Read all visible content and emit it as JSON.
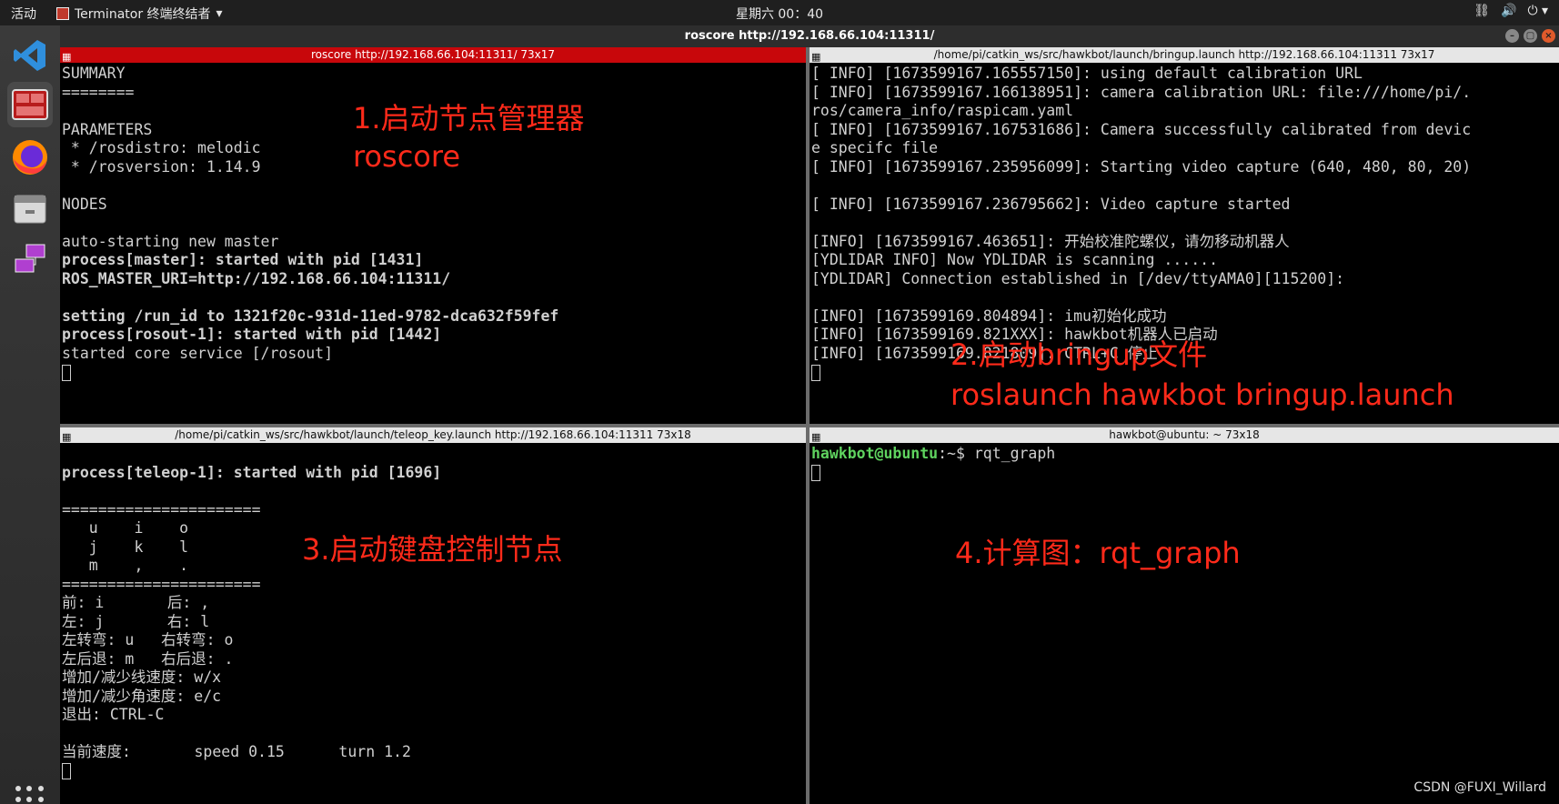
{
  "topbar": {
    "activities": "活动",
    "app_name": "Terminator 终端终结者",
    "clock": "星期六 00：40",
    "tray": [
      "network-icon",
      "volume-icon",
      "power-icon"
    ]
  },
  "window": {
    "title": "roscore http://192.168.66.104:11311/"
  },
  "panes": {
    "top_left": {
      "title": "roscore http://192.168.66.104:11311/ 73x17",
      "lines": [
        "SUMMARY",
        "========",
        "",
        "PARAMETERS",
        " * /rosdistro: melodic",
        " * /rosversion: 1.14.9",
        "",
        "NODES",
        "",
        "auto-starting new master",
        "process[master]: started with pid [1431]",
        "ROS_MASTER_URI=http://192.168.66.104:11311/",
        "",
        "setting /run_id to 1321f20c-931d-11ed-9782-dca632f59fef",
        "process[rosout-1]: started with pid [1442]",
        "started core service [/rosout]"
      ]
    },
    "top_right": {
      "title": "/home/pi/catkin_ws/src/hawkbot/launch/bringup.launch http://192.168.66.104:11311 73x17",
      "lines": [
        "[ INFO] [1673599167.165557150]: using default calibration URL",
        "[ INFO] [1673599167.166138951]: camera calibration URL: file:///home/pi/.",
        "ros/camera_info/raspicam.yaml",
        "[ INFO] [1673599167.167531686]: Camera successfully calibrated from devic",
        "e specifc file",
        "[ INFO] [1673599167.235956099]: Starting video capture (640, 480, 80, 20)",
        "",
        "[ INFO] [1673599167.236795662]: Video capture started",
        "",
        "[INFO] [1673599167.463651]: 开始校准陀螺仪，请勿移动机器人",
        "[YDLIDAR INFO] Now YDLIDAR is scanning ......",
        "[YDLIDAR] Connection established in [/dev/ttyAMA0][115200]:",
        "",
        "[INFO] [1673599169.804894]: imu初始化成功",
        "[INFO] [1673599169.821XXX]: hawkbot机器人已启动",
        "[INFO] [1673599169.821809]: CTRL+C 停止"
      ]
    },
    "bottom_left": {
      "title": "/home/pi/catkin_ws/src/hawkbot/launch/teleop_key.launch http://192.168.66.104:11311 73x18",
      "lines": [
        "",
        "process[teleop-1]: started with pid [1696]",
        "",
        "======================",
        "   u    i    o",
        "   j    k    l",
        "   m    ,    .",
        "======================",
        "前: i       后: ,",
        "左: j       右: l",
        "左转弯: u   右转弯: o",
        "左后退: m   右后退: .",
        "增加/减少线速度: w/x",
        "增加/减少角速度: e/c",
        "退出: CTRL-C",
        "",
        "当前速度:       speed 0.15      turn 1.2"
      ]
    },
    "bottom_right": {
      "title": "hawkbot@ubuntu: ~ 73x18",
      "prompt_user": "hawkbot@ubuntu",
      "prompt_path": ":~$ ",
      "command": "rqt_graph"
    }
  },
  "annotations": {
    "a1_line1": "1.启动节点管理器",
    "a1_line2": "roscore",
    "a2_line1": "2.启动bringup文件",
    "a2_line2": "roslaunch hawkbot bringup.launch",
    "a3": "3.启动键盘控制节点",
    "a4": "4.计算图：rqt_graph"
  },
  "watermark": "CSDN @FUXI_Willard",
  "colors": {
    "active_title": "#c8070b",
    "annotation": "#ff2a1a",
    "prompt": "#5fd35f"
  }
}
